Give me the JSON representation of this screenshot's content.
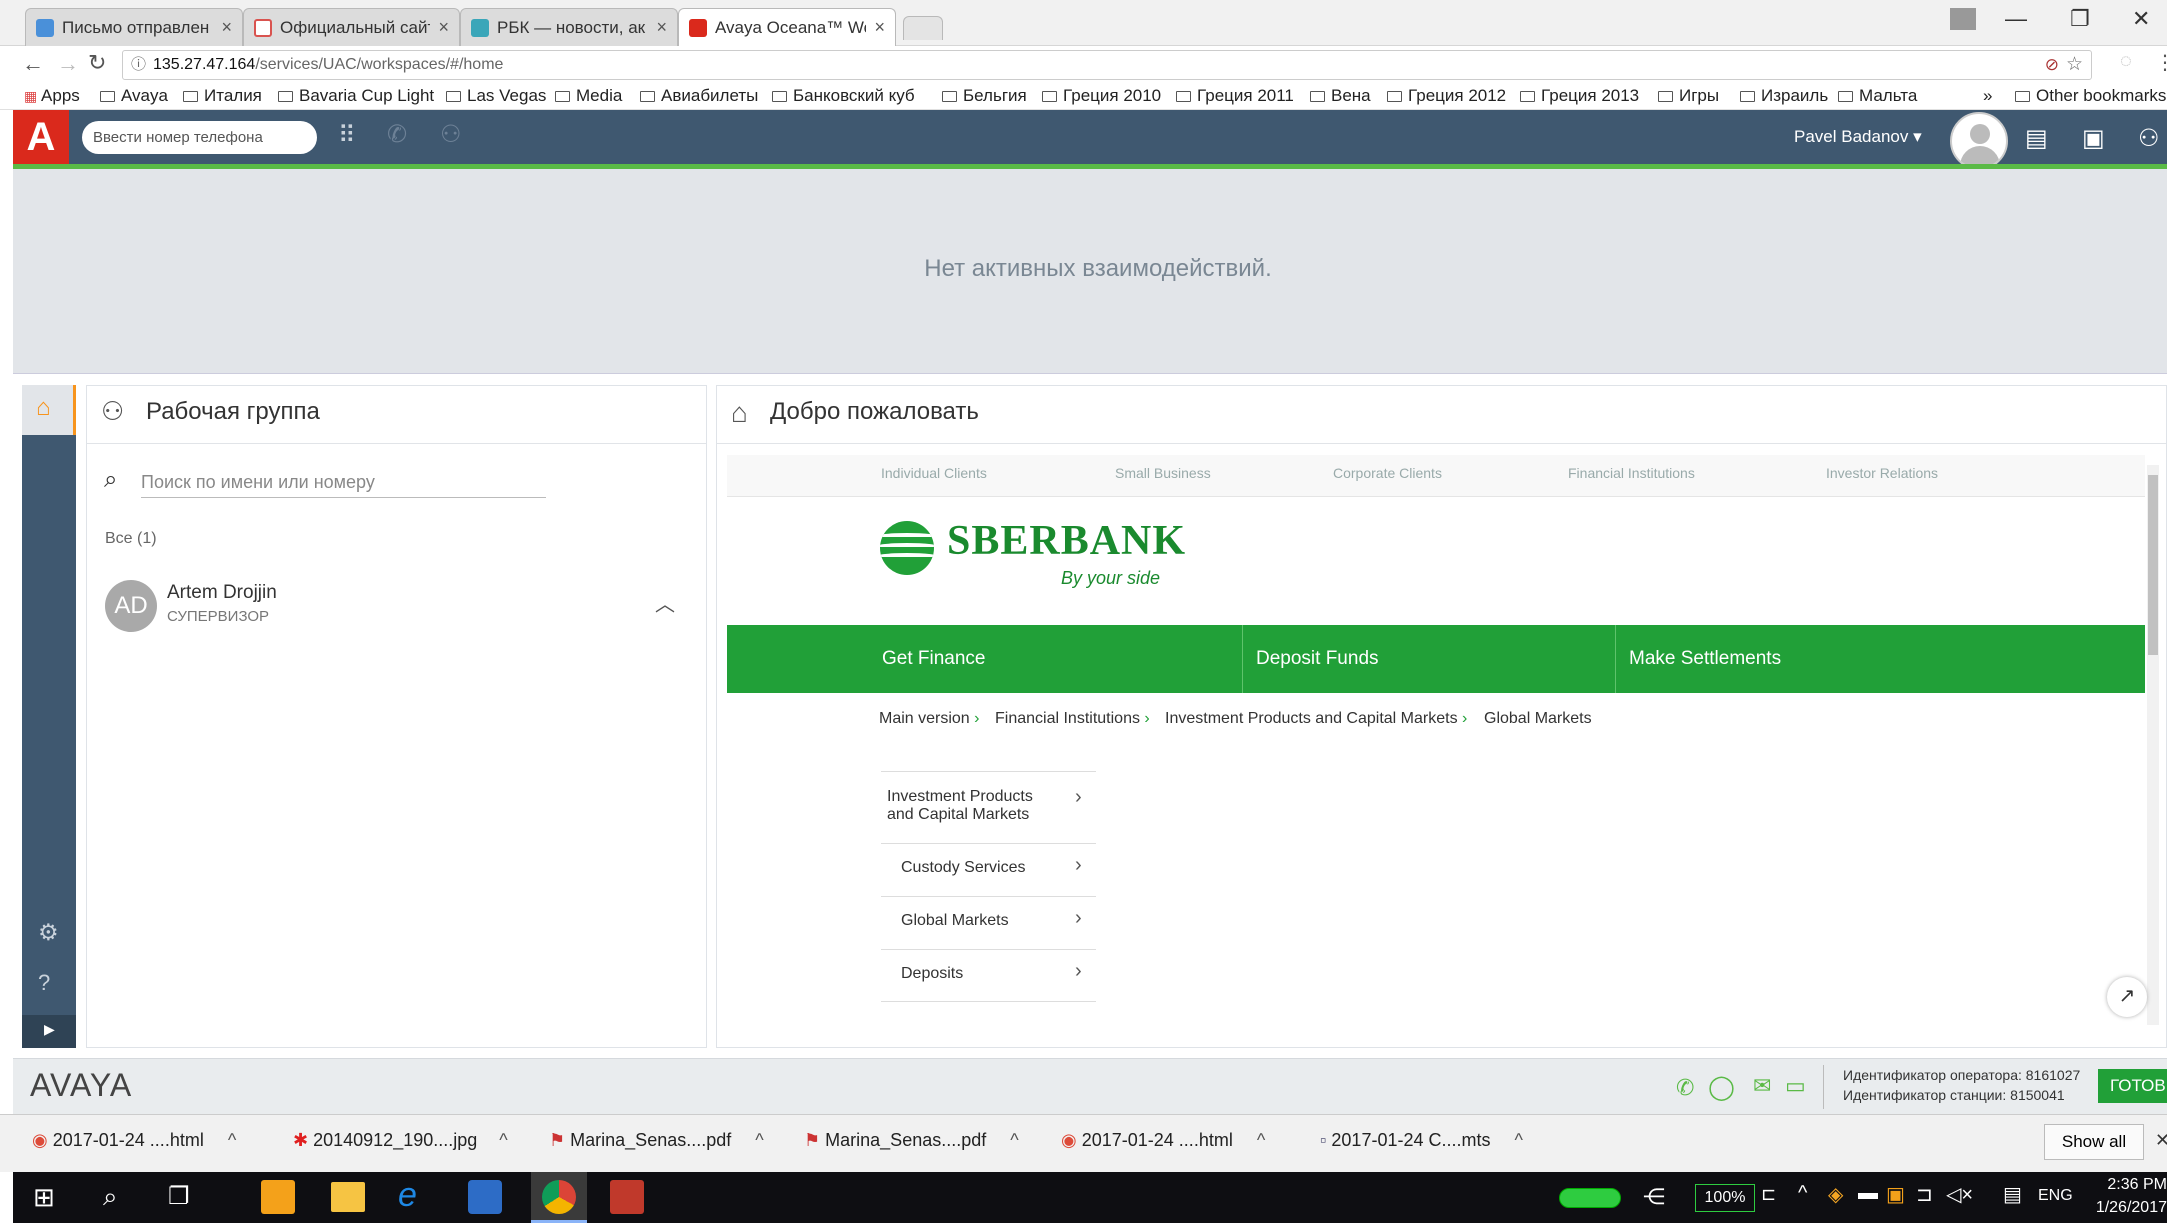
{
  "browser": {
    "tabs": [
      {
        "title": "Письмо отправлен",
        "favicon_color": "#4a90d9"
      },
      {
        "title": "Официальный сайт",
        "favicon_color": "#d9534f"
      },
      {
        "title": "РБК — новости, ак",
        "favicon_color": "#3aa6b9"
      },
      {
        "title": "Avaya Oceana™ Wo",
        "favicon_color": "#da291c"
      }
    ],
    "url_host": "135.27.47.164",
    "url_path": "/services/UAC/workspaces/#/home",
    "bookmarks": [
      "Apps",
      "Avaya",
      "Италия",
      "Bavaria Cup Light",
      "Las Vegas",
      "Media",
      "Авиабилеты",
      "Банковский куб",
      "Бельгия",
      "Греция 2010",
      "Греция 2011",
      "Вена",
      "Греция 2012",
      "Греция 2013",
      "Игры",
      "Израиль",
      "Мальта"
    ],
    "bookmarks_overflow": "»",
    "other_bookmarks": "Other bookmarks"
  },
  "header": {
    "logo": "A",
    "phone_placeholder": "Ввести номер телефона",
    "user_name": "Pavel Badanov"
  },
  "interactions": {
    "empty_text": "Нет активных взаимодействий."
  },
  "workgroup": {
    "title": "Рабочая группа",
    "search_placeholder": "Поиск по имени или номеру",
    "filter_label": "Все (1)",
    "members": [
      {
        "initials": "AD",
        "name": "Artem Drojjin",
        "role": "СУПЕРВИЗОР"
      }
    ]
  },
  "welcome": {
    "title": "Добро пожаловать",
    "site": {
      "top_nav": [
        "Individual Clients",
        "Small Business",
        "Corporate Clients",
        "Financial Institutions",
        "Investor Relations"
      ],
      "brand": "SBERBANK",
      "slogan": "By your side",
      "main_nav": [
        "Get Finance",
        "Deposit Funds",
        "Make Settlements"
      ],
      "breadcrumbs": [
        "Main version",
        "Financial Institutions",
        "Investment Products and Capital Markets",
        "Global Markets"
      ],
      "menu": [
        {
          "label_line1": "Investment Products",
          "label_line2": "and Capital Markets"
        },
        {
          "label_line1": "Custody Services",
          "label_line2": ""
        },
        {
          "label_line1": "Global Markets",
          "label_line2": ""
        },
        {
          "label_line1": "Deposits",
          "label_line2": ""
        }
      ]
    }
  },
  "footer": {
    "brand": "AVAYA",
    "operator_id": "Идентификатор оператора: 8161027",
    "station_id": "Идентификатор станции: 8150041",
    "status": "ГОТОВ"
  },
  "downloads": {
    "items": [
      "2017-01-24 ....html",
      "20140912_190....jpg",
      "Marina_Senas....pdf",
      "Marina_Senas....pdf",
      "2017-01-24 ....html",
      "2017-01-24 C....mts"
    ],
    "show_all": "Show all"
  },
  "taskbar": {
    "battery": "100%",
    "lang": "ENG",
    "time": "2:36 PM",
    "date": "1/26/2017"
  }
}
